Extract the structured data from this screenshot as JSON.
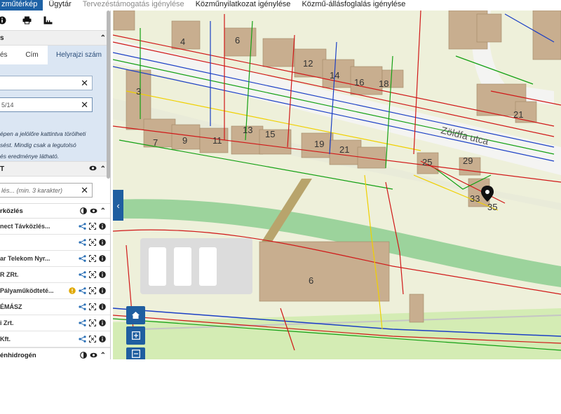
{
  "topnav": {
    "tabs": [
      {
        "label": "zműtérkép"
      },
      {
        "label": "Ügytár"
      },
      {
        "label": "Tervezéstámogatás igénylése"
      },
      {
        "label": "Közműnyilatkozat igénylése"
      },
      {
        "label": "Közmű-állásfoglalás igénylése"
      }
    ]
  },
  "toolbar": {
    "icons": [
      "info-icon",
      "print-icon",
      "measure-icon"
    ]
  },
  "search": {
    "header_label": "s",
    "tabs": [
      {
        "label": "és"
      },
      {
        "label": "Cím"
      },
      {
        "label": "Helyrajzi szám"
      }
    ],
    "field1_value": "",
    "field2_value": "5/14",
    "hint": "épen a jelölőre kattintva törölheti\nsést. Mindig csak a legutolsó\nés eredménye látható."
  },
  "layers": {
    "header_label": "T",
    "filter_placeholder": "lés... (min. 3 karakter)",
    "groups": [
      {
        "label": "rközlés",
        "items": [
          {
            "label": "nect Távközlés..."
          },
          {
            "label": ""
          },
          {
            "label": "ar Telekom Nyr..."
          },
          {
            "label": "R ZRt."
          },
          {
            "label": "Pályaműködteté..."
          },
          {
            "label": "ÉMÁSZ"
          },
          {
            "label": "i Zrt."
          },
          {
            "label": "Kft."
          }
        ]
      },
      {
        "label": "énhidrogén"
      }
    ]
  },
  "map": {
    "street_label": "Zöldfa utca",
    "house_numbers": [
      "4",
      "6",
      "12",
      "14",
      "16",
      "18",
      "21",
      "3",
      "7",
      "9",
      "11",
      "13",
      "15",
      "19",
      "21",
      "25",
      "29",
      "33",
      "35",
      "6"
    ],
    "colors": {
      "building": "#c8ae8f",
      "road": "#f4f4f2",
      "parkland": "#d4ecb4",
      "river": "#9cd39c",
      "gas": "#f0d000",
      "water": "#1b3fc5",
      "electric": "#d01818",
      "telecom": "#13a013",
      "accent": "#1f5ea0"
    }
  }
}
